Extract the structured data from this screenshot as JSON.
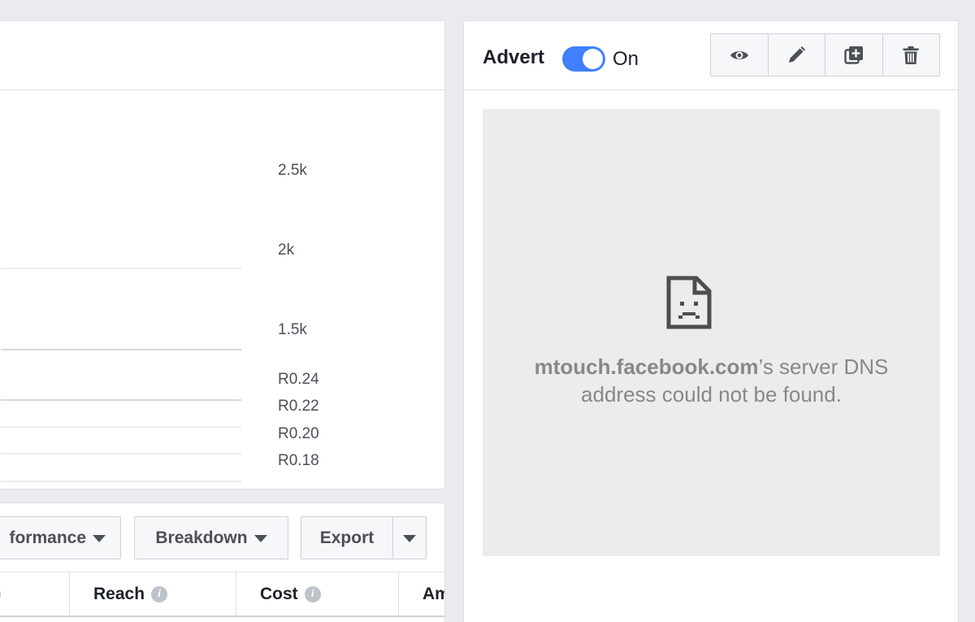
{
  "chart": {
    "tick_labels": [
      "2.5k",
      "2k",
      "1.5k",
      "R0.24",
      "R0.22",
      "R0.20",
      "R0.18"
    ]
  },
  "toolbar": {
    "performance_label": "formance",
    "breakdown_label": "Breakdown",
    "export_label": "Export"
  },
  "table": {
    "columns": [
      "Reach",
      "Cost",
      "Am"
    ]
  },
  "advert": {
    "title": "Advert",
    "toggle_label": "On",
    "toggle_state": "on",
    "accent_color": "#4080ff",
    "actions": [
      "eye-icon",
      "pencil-icon",
      "duplicate-icon",
      "trash-icon"
    ]
  },
  "preview": {
    "error_host": "mtouch.facebook.com",
    "error_line1_rest": "’s server DNS",
    "error_line2": "address could not be found."
  }
}
